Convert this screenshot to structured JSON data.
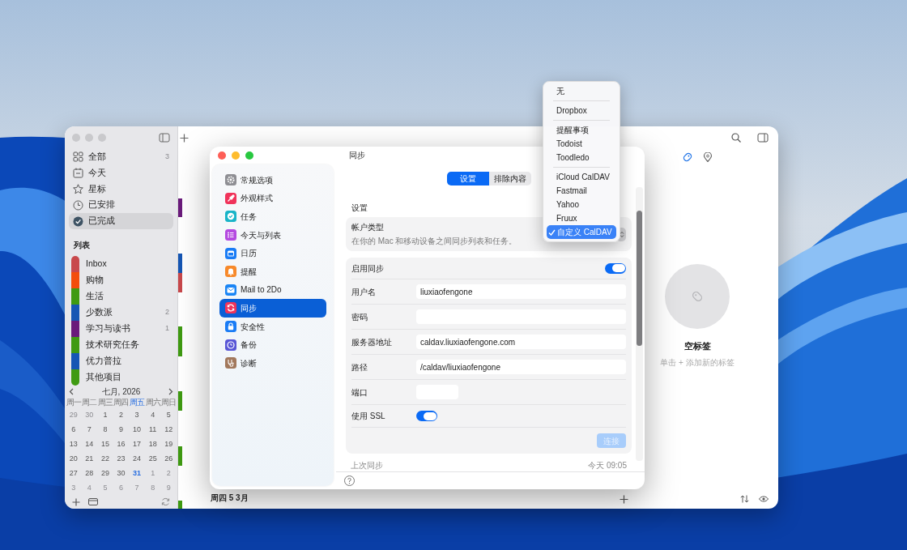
{
  "main_window": {
    "sidebar": {
      "smart_lists": [
        {
          "label": "全部",
          "count": "3",
          "selected": false
        },
        {
          "label": "今天",
          "selected": false
        },
        {
          "label": "星标",
          "selected": false
        },
        {
          "label": "已安排",
          "selected": false
        },
        {
          "label": "已完成",
          "selected": true
        }
      ],
      "lists_heading": "列表",
      "lists": [
        {
          "label": "Inbox",
          "color": "#c8484b"
        },
        {
          "label": "购物",
          "color": "#f34d0c"
        },
        {
          "label": "生活",
          "color": "#3f9a12"
        },
        {
          "label": "少数派",
          "color": "#1656b4",
          "count": "2"
        },
        {
          "label": "学习与读书",
          "color": "#6a1b7b",
          "count": "1"
        },
        {
          "label": "技术研究任务",
          "color": "#3f9a12"
        },
        {
          "label": "优力普拉",
          "color": "#1656b4"
        },
        {
          "label": "其他项目",
          "color": "#3f9a12"
        }
      ],
      "calendar": {
        "title": "七月, 2026",
        "weekdays": [
          {
            "label": "周一",
            "today": false
          },
          {
            "label": "周二",
            "today": false
          },
          {
            "label": "周三",
            "today": false
          },
          {
            "label": "周四",
            "today": false
          },
          {
            "label": "周五",
            "today": true
          },
          {
            "label": "周六",
            "today": false
          },
          {
            "label": "周日",
            "today": false
          }
        ],
        "weeks": [
          [
            {
              "day": "29",
              "kind": "other"
            },
            {
              "day": "30",
              "kind": "other"
            },
            {
              "day": "1",
              "kind": "current"
            },
            {
              "day": "2",
              "kind": "current"
            },
            {
              "day": "3",
              "kind": "current"
            },
            {
              "day": "4",
              "kind": "current"
            },
            {
              "day": "5",
              "kind": "current"
            }
          ],
          [
            {
              "day": "6",
              "kind": "current"
            },
            {
              "day": "7",
              "kind": "current"
            },
            {
              "day": "8",
              "kind": "current"
            },
            {
              "day": "9",
              "kind": "current"
            },
            {
              "day": "10",
              "kind": "current"
            },
            {
              "day": "11",
              "kind": "current"
            },
            {
              "day": "12",
              "kind": "current"
            }
          ],
          [
            {
              "day": "13",
              "kind": "current"
            },
            {
              "day": "14",
              "kind": "current"
            },
            {
              "day": "15",
              "kind": "current"
            },
            {
              "day": "16",
              "kind": "current"
            },
            {
              "day": "17",
              "kind": "current"
            },
            {
              "day": "18",
              "kind": "current"
            },
            {
              "day": "19",
              "kind": "current"
            }
          ],
          [
            {
              "day": "20",
              "kind": "current"
            },
            {
              "day": "21",
              "kind": "current"
            },
            {
              "day": "22",
              "kind": "current"
            },
            {
              "day": "23",
              "kind": "current"
            },
            {
              "day": "24",
              "kind": "current"
            },
            {
              "day": "25",
              "kind": "current"
            },
            {
              "day": "26",
              "kind": "current"
            }
          ],
          [
            {
              "day": "27",
              "kind": "current"
            },
            {
              "day": "28",
              "kind": "current"
            },
            {
              "day": "29",
              "kind": "current"
            },
            {
              "day": "30",
              "kind": "current"
            },
            {
              "day": "31",
              "kind": "today"
            },
            {
              "day": "1",
              "kind": "other"
            },
            {
              "day": "2",
              "kind": "other"
            }
          ],
          [
            {
              "day": "3",
              "kind": "other"
            },
            {
              "day": "4",
              "kind": "other"
            },
            {
              "day": "5",
              "kind": "other"
            },
            {
              "day": "6",
              "kind": "other"
            },
            {
              "day": "7",
              "kind": "other"
            },
            {
              "day": "8",
              "kind": "other"
            },
            {
              "day": "9",
              "kind": "other"
            }
          ]
        ]
      }
    },
    "task_markers": [
      {
        "color": "#6a1b7b"
      },
      {
        "color": "#1656b4"
      },
      {
        "color": "#c8484b"
      },
      {
        "color": "#3f9a12"
      },
      {
        "color": "#3f9a12"
      },
      {
        "color": "#3f9a12"
      },
      {
        "color": "#3f9a12"
      }
    ],
    "day_header": "周四 5 3月",
    "tag_panel": {
      "tabs": [
        {
          "selected": true
        },
        {
          "selected": false
        }
      ],
      "empty_title": "空标签",
      "empty_hint": "单击 + 添加新的标签"
    }
  },
  "settings_window": {
    "title": "同步",
    "nav": [
      {
        "label": "常规选项",
        "color": "#8e8e93",
        "selected": false
      },
      {
        "label": "外观样式",
        "color": "#f0335a",
        "selected": false
      },
      {
        "label": "任务",
        "color": "#19b4c8",
        "selected": false
      },
      {
        "label": "今天与列表",
        "color": "#b44ae0",
        "selected": false
      },
      {
        "label": "日历",
        "color": "#1a7cf5",
        "selected": false
      },
      {
        "label": "提醒",
        "color": "#f7892a",
        "selected": false
      },
      {
        "label": "Mail to 2Do",
        "color": "#1a85f5",
        "selected": false
      },
      {
        "label": "同步",
        "color": "#f0335a",
        "selected": true
      },
      {
        "label": "安全性",
        "color": "#1a7cf5",
        "selected": false
      },
      {
        "label": "备份",
        "color": "#5856d6",
        "selected": false
      },
      {
        "label": "诊断",
        "color": "#a2785c",
        "selected": false
      }
    ],
    "segments": [
      {
        "label": "设置",
        "selected": true
      },
      {
        "label": "排除内容",
        "selected": false
      }
    ],
    "section": "设置",
    "account_type": {
      "label": "帐户类型",
      "description": "在你的 Mac 和移动设备之间同步列表和任务。"
    },
    "enable_sync": {
      "label": "启用同步",
      "on": true
    },
    "fields": [
      {
        "label": "用户名",
        "value": "liuxiaofengone",
        "kind": "wide"
      },
      {
        "label": "密码",
        "kind": "wide"
      },
      {
        "label": "服务器地址",
        "value": "caldav.liuxiaofengone.com",
        "kind": "wide"
      },
      {
        "label": "路径",
        "value": "/caldav/liuxiaofengone",
        "kind": "wide"
      },
      {
        "label": "端口",
        "kind": "short"
      }
    ],
    "ssl": {
      "label": "使用 SSL",
      "on": true
    },
    "connect_button": {
      "label": "连接",
      "disabled": true
    },
    "last_sync": {
      "label": "上次同步",
      "value": "今天 09:05"
    }
  },
  "account_menu": {
    "groups": [
      [
        {
          "label": "无",
          "selected": false
        }
      ],
      [
        {
          "label": "Dropbox",
          "selected": false
        }
      ],
      [
        {
          "label": "提醒事项",
          "selected": false
        },
        {
          "label": "Todoist",
          "selected": false
        },
        {
          "label": "Toodledo",
          "selected": false
        }
      ],
      [
        {
          "label": "iCloud CalDAV",
          "selected": false
        },
        {
          "label": "Fastmail",
          "selected": false
        },
        {
          "label": "Yahoo",
          "selected": false
        },
        {
          "label": "Fruux",
          "selected": false
        },
        {
          "label": "自定义 CalDAV",
          "selected": true
        }
      ]
    ]
  }
}
